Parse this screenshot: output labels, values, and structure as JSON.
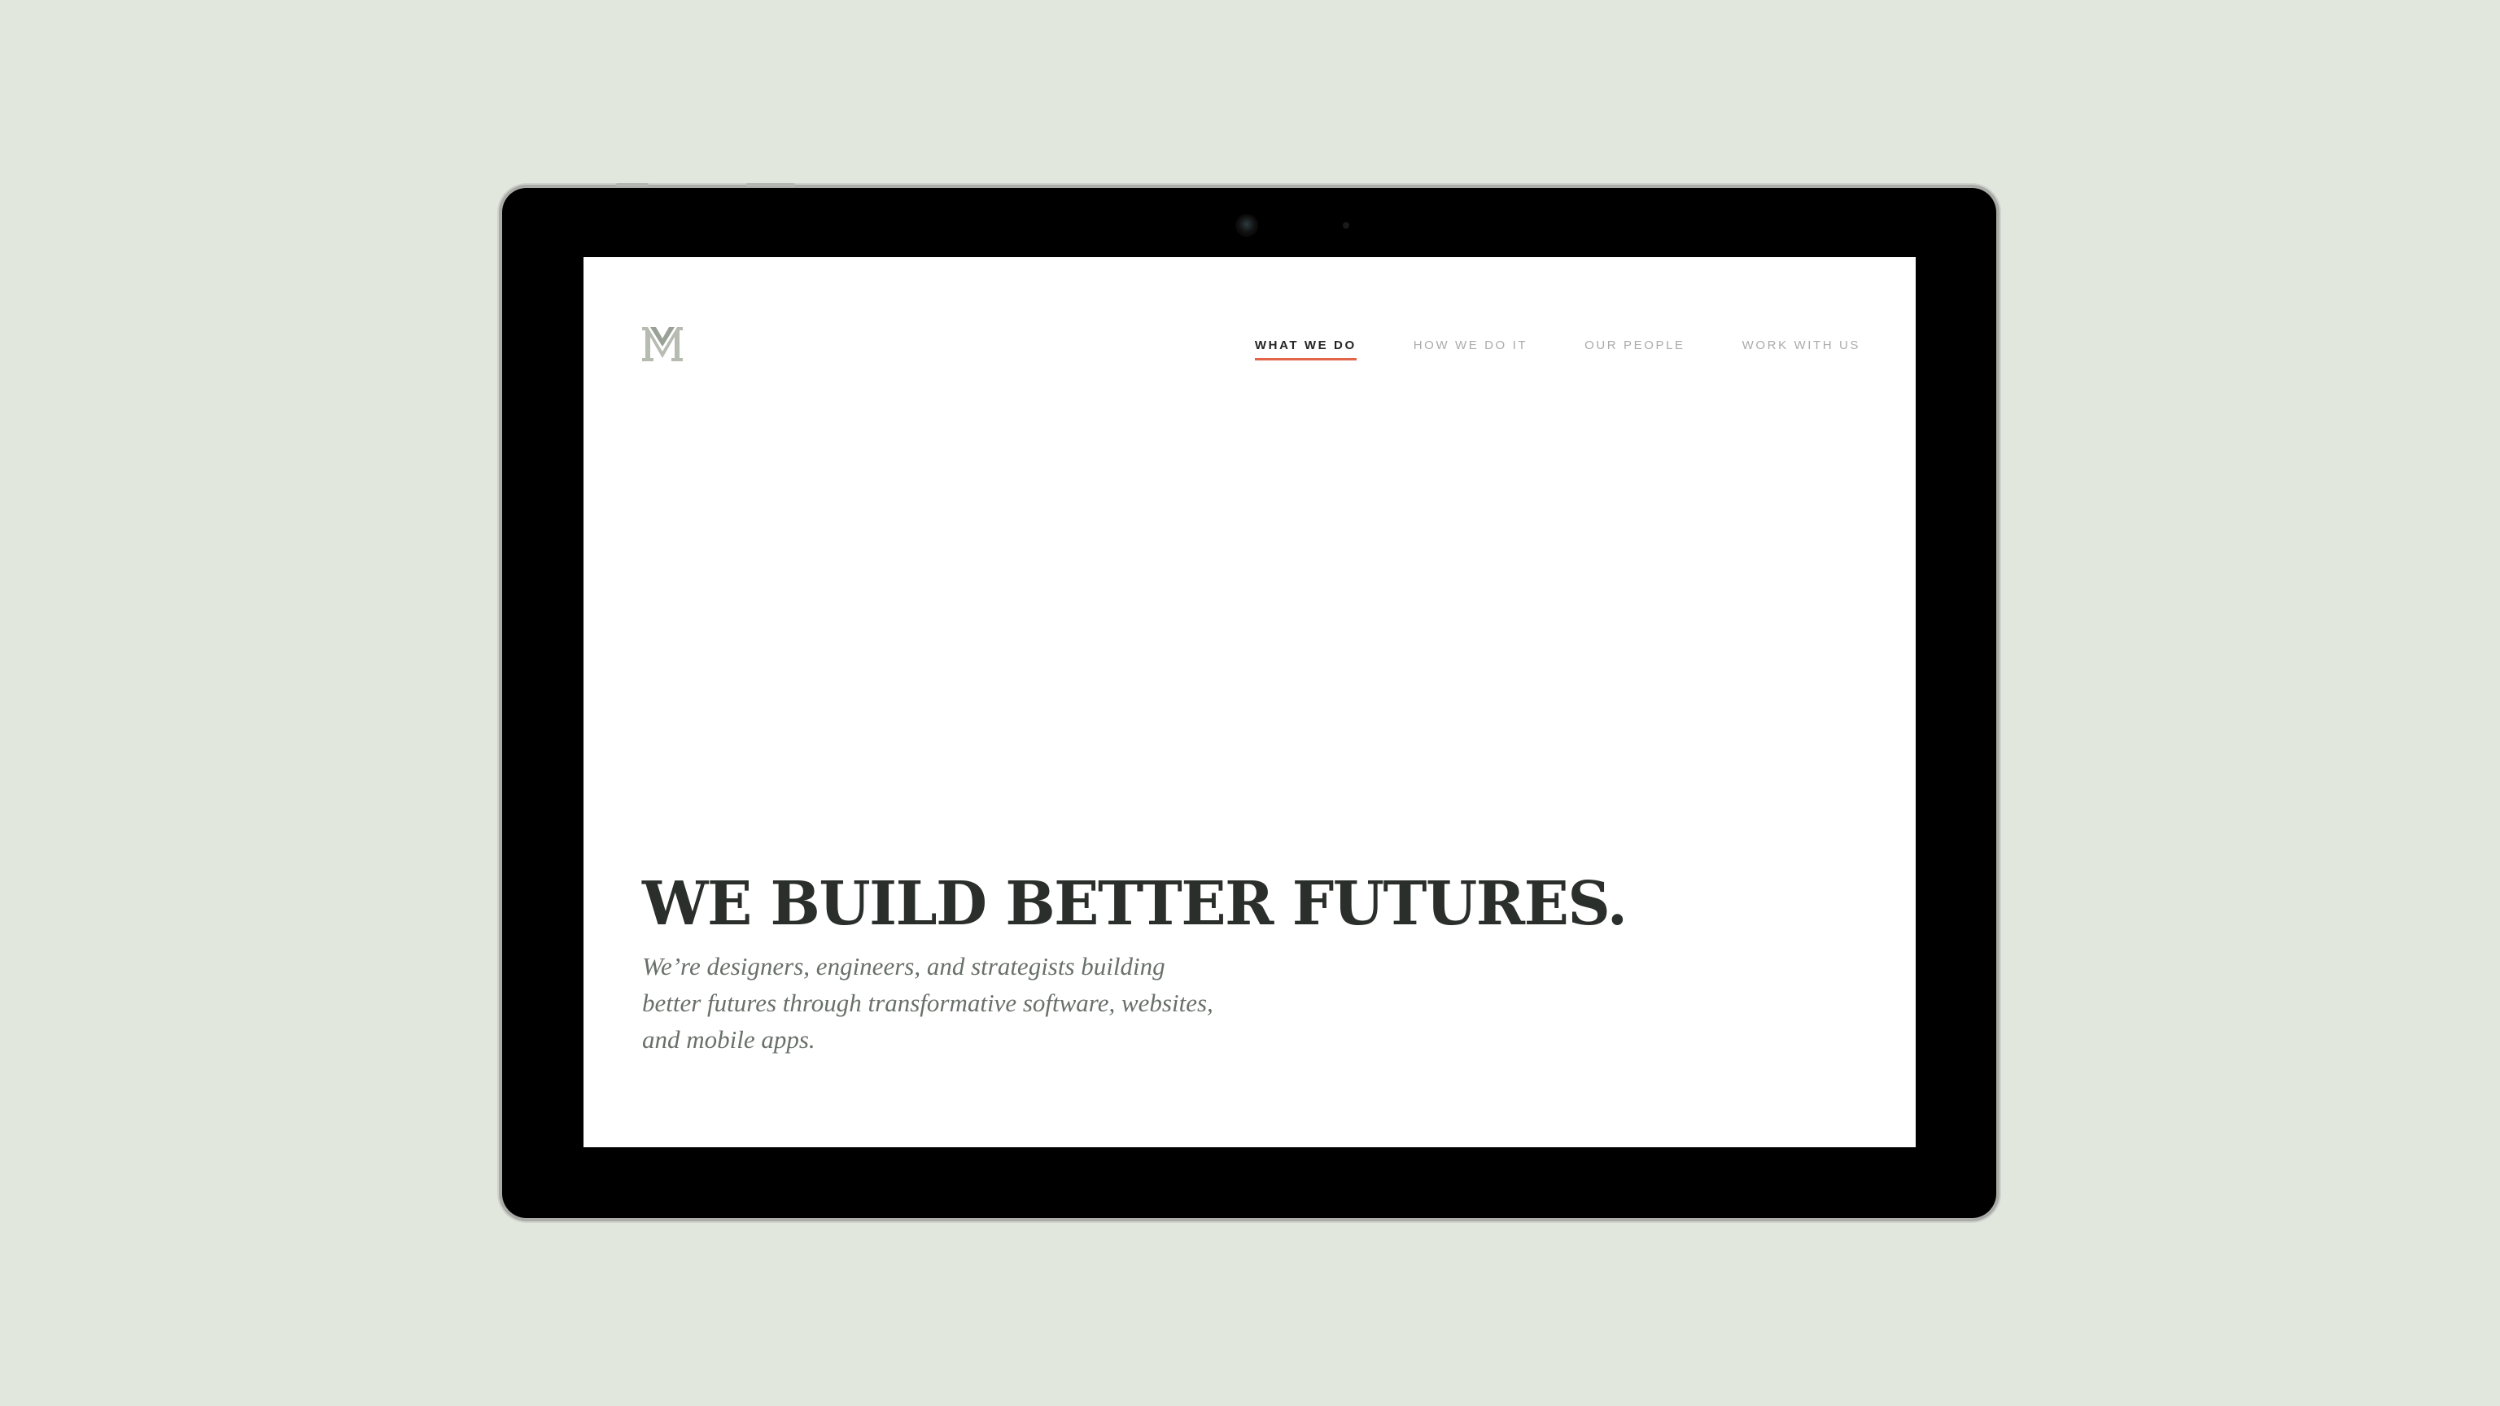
{
  "colors": {
    "background": "#e2e7de",
    "accent": "#e2654a",
    "heading": "#2b2f2c",
    "nav_inactive": "#a9aca9",
    "body_text": "#69706a"
  },
  "site": {
    "logo_icon": "monogram-logo-icon"
  },
  "nav": {
    "items": [
      {
        "label": "WHAT WE DO",
        "active": true
      },
      {
        "label": "HOW WE DO IT",
        "active": false
      },
      {
        "label": "OUR PEOPLE",
        "active": false
      },
      {
        "label": "WORK WITH US",
        "active": false
      }
    ]
  },
  "hero": {
    "title": "WE BUILD BETTER FUTURES.",
    "subtitle": "We’re designers, engineers, and strategists building better futures through transformative software, websites, and mobile apps."
  }
}
